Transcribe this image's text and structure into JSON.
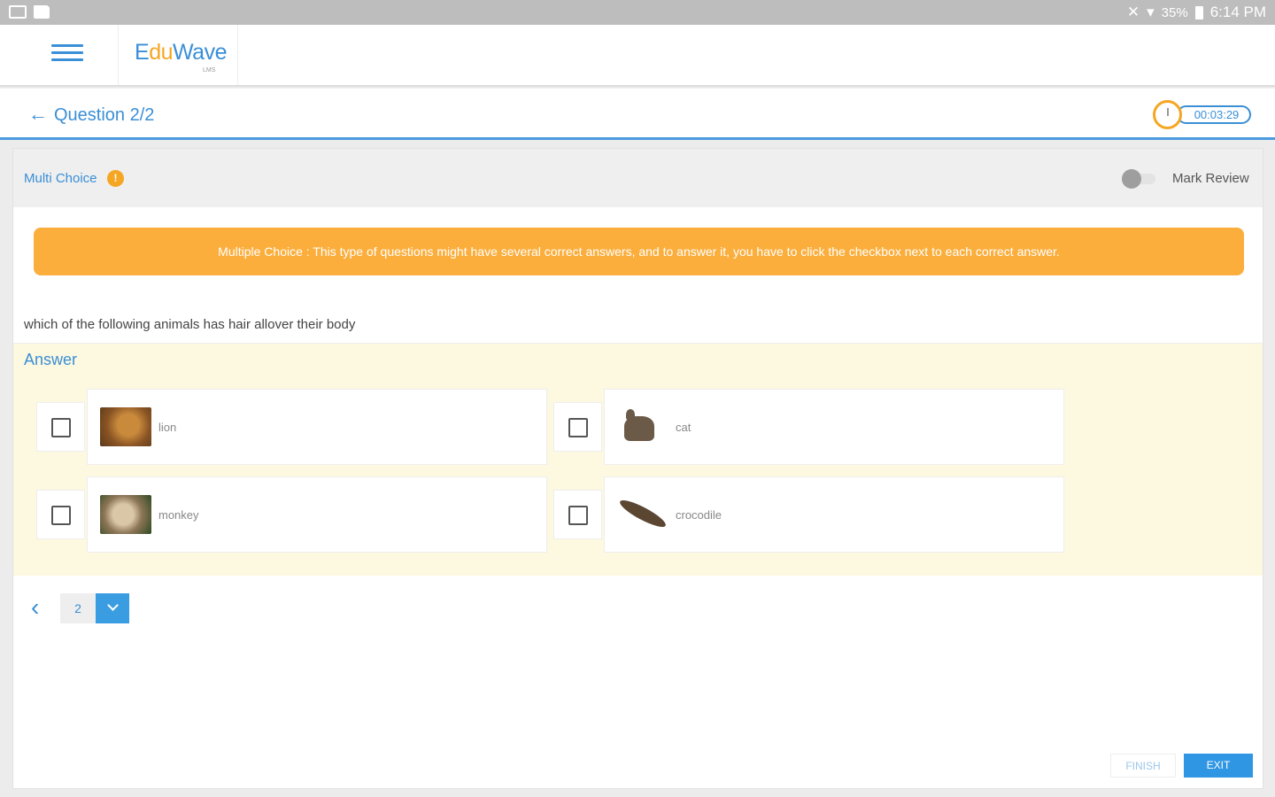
{
  "status_bar": {
    "battery": "35%",
    "time": "6:14 PM"
  },
  "app": {
    "logo_e": "E",
    "logo_du": "du",
    "logo_wave": "Wave",
    "logo_sub": "LMS"
  },
  "question_header": {
    "title": "Question 2/2",
    "timer": "00:03:29"
  },
  "card": {
    "question_type": "Multi Choice",
    "info_badge": "!",
    "mark_review_label": "Mark Review",
    "mark_review_on": false,
    "notice": "Multiple Choice : This type of questions might have several correct answers, and to answer it, you have to click the checkbox next to each correct answer.",
    "question_text": "which of the following animals has hair allover their body",
    "answer_label": "Answer",
    "options": [
      {
        "label": "lion",
        "checked": false,
        "image": "lion-photo"
      },
      {
        "label": "cat",
        "checked": false,
        "image": "cat-photo"
      },
      {
        "label": "monkey",
        "checked": false,
        "image": "monkey-photo"
      },
      {
        "label": "crocodile",
        "checked": false,
        "image": "crocodile-photo"
      }
    ]
  },
  "pager": {
    "current_page": "2"
  },
  "actions": {
    "finish": "FINISH",
    "exit": "EXIT"
  },
  "colors": {
    "primary": "#3a8fd6",
    "accent": "#f5a623",
    "notice_bg": "#fbae3c",
    "answer_bg": "#fdf8e0",
    "exit_bg": "#2f96e4"
  }
}
